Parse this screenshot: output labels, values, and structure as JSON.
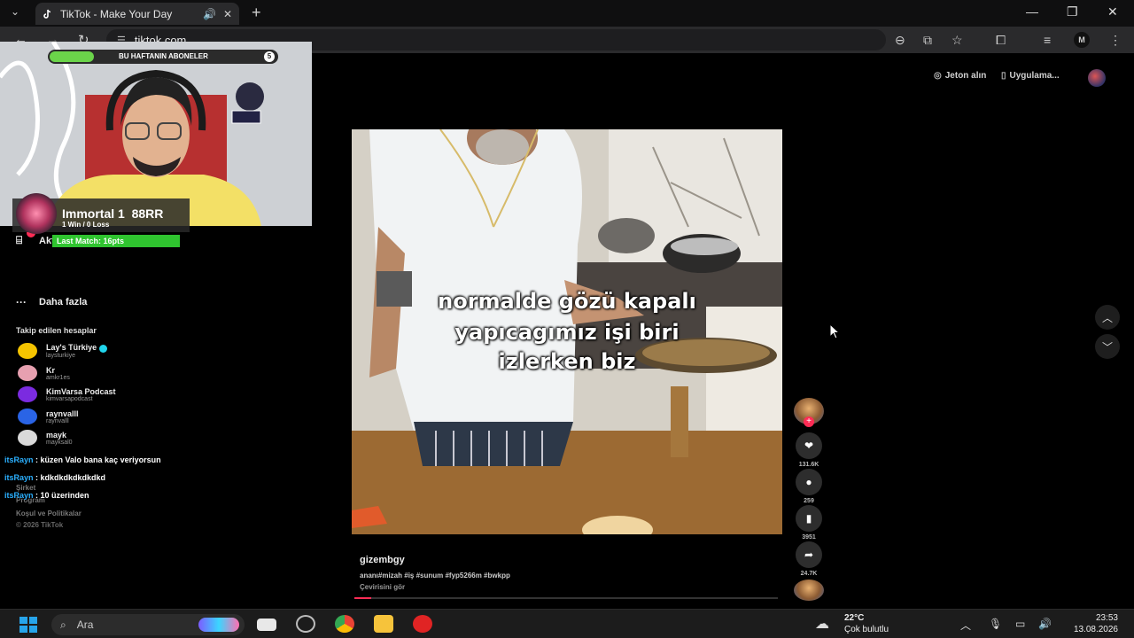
{
  "browser": {
    "tab_title": "TikTok - Make Your Day",
    "url": "tiktok.com"
  },
  "tiktok": {
    "header": {
      "get_coins": "Jeton alın",
      "get_app": "Uygulama..."
    },
    "sidebar": {
      "activity": "Aktivite",
      "more": "Daha fazla",
      "following_title": "Takip edilen hesaplar",
      "accounts": [
        {
          "name": "Lay's Türkiye",
          "handle": "laysturkiye",
          "verified": true,
          "color": "#f5c400"
        },
        {
          "name": "Kr",
          "handle": "amkr1es",
          "verified": false,
          "color": "#e7a0b0"
        },
        {
          "name": "KimVarsa Podcast",
          "handle": "kimvarsapodcast",
          "verified": false,
          "color": "#7b2be0"
        },
        {
          "name": "raynvalll",
          "handle": "raynvalll",
          "verified": false,
          "color": "#2a64e6"
        },
        {
          "name": "mayk",
          "handle": "mayksal0",
          "verified": false,
          "color": "#d9d9d9"
        }
      ],
      "footer": {
        "company": "Şirket",
        "program": "Program",
        "terms": "Koşul ve Politikalar",
        "copyright": "© 2026 TikTok"
      }
    },
    "video": {
      "caption_lines": [
        "normalde gözü kapalı",
        "yapıcagımız işi biri",
        "izlerken biz"
      ],
      "author": "gizembgy",
      "description": "ananı#mizah #iş #sunum #fyp5266m #bwkpp",
      "see_translation": "Çevirisini gör",
      "progress_percent": 4
    },
    "actions": {
      "likes": "131.6K",
      "comments": "259",
      "saves": "3951",
      "shares": "24.7K"
    }
  },
  "stream_overlay": {
    "subs_goal_label": "BU HAFTANIN ABONELER",
    "subs_goal_count": "5",
    "rank_name": "Immortal 1",
    "rank_rr": "88RR",
    "rank_record": "1 Win / 0 Loss",
    "last_match": "Last Match: 16pts",
    "chat": [
      {
        "user": "itsRayn",
        "message": ": küzen Valo bana kaç veriyorsun"
      },
      {
        "user": "itsRayn",
        "message": ": kdkdkdkdkdkdkd"
      },
      {
        "user": "itsRayn",
        "message": ": 10 üzerinden"
      }
    ]
  },
  "taskbar": {
    "search_placeholder": "Ara",
    "weather_temp": "22°C",
    "weather_desc": "Çok bulutlu",
    "time": "23:53",
    "date": "13.08.2026"
  }
}
